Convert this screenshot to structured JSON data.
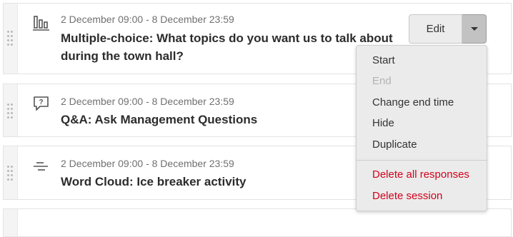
{
  "sessions": [
    {
      "date": "2 December 09:00 - 8 December 23:59",
      "title": "Multiple-choice: What topics do you want us to talk about during the town hall?",
      "icon": "bar-chart-icon"
    },
    {
      "date": "2 December 09:00 - 8 December 23:59",
      "title": "Q&A: Ask Management Questions",
      "icon": "question-bubble-icon"
    },
    {
      "date": "2 December 09:00 - 8 December 23:59",
      "title": "Word Cloud: Ice breaker activity",
      "icon": "word-cloud-icon"
    }
  ],
  "actions": {
    "edit_label": "Edit"
  },
  "menu": {
    "items": [
      {
        "label": "Start",
        "state": "enabled"
      },
      {
        "label": "End",
        "state": "disabled"
      },
      {
        "label": "Change end time",
        "state": "enabled"
      },
      {
        "label": "Hide",
        "state": "enabled"
      },
      {
        "label": "Duplicate",
        "state": "enabled"
      },
      {
        "label": "Delete all responses",
        "state": "danger"
      },
      {
        "label": "Delete session",
        "state": "danger"
      }
    ]
  },
  "colors": {
    "danger": "#d0021b",
    "disabled_text": "#b3b3b3",
    "secondary_text": "#707070"
  }
}
